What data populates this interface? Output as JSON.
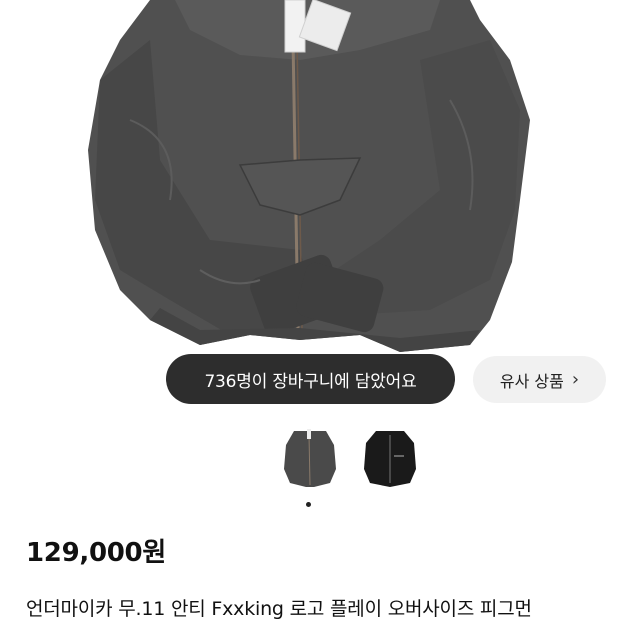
{
  "product": {
    "cart_notice": "736명이 장바구니에 담았어요",
    "similar_button_label": "유사 상품",
    "similar_chevron": "›",
    "price": "129,000원",
    "title": "언더마이카 무.11 안티 Fxxking 로고 플레이 오버사이즈 피그먼"
  },
  "gallery": {
    "thumbnails": [
      {
        "icon": "jacket-gray-thumbnail",
        "color": "#4a4a4a"
      },
      {
        "icon": "jacket-black-thumbnail",
        "color": "#1a1a1a"
      }
    ],
    "active_index": 0
  },
  "colors": {
    "jacket": "#505050",
    "pill": "#2d2d2d",
    "button_bg": "#f1f1f1"
  }
}
